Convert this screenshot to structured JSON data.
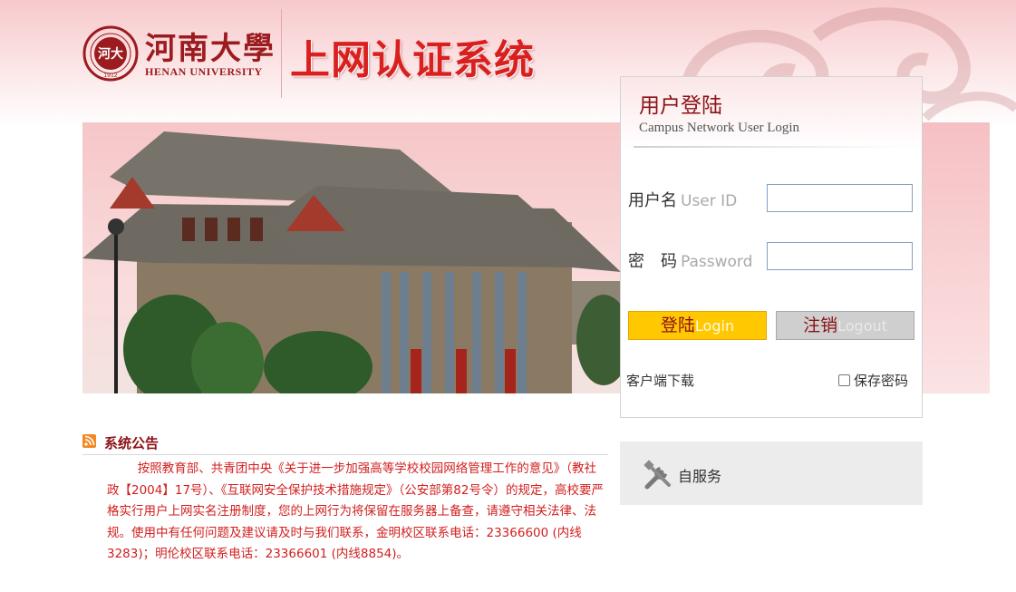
{
  "header": {
    "university_name_cn": "河南大學",
    "university_name_en": "HENAN UNIVERSITY",
    "seal_text": "HENAN UNIVERSITY 1912",
    "system_title": "上网认证系统"
  },
  "login": {
    "title": "用户登陆",
    "subtitle": "Campus Network User Login",
    "username_label": "用户名",
    "username_label_en": "User ID",
    "username_value": "",
    "password_label": "密　码",
    "password_label_en": "Password",
    "password_value": "",
    "login_button": "登陆",
    "login_button_en": "Login",
    "logout_button": "注销",
    "logout_button_en": "Logout",
    "client_download": "客户端下载",
    "remember_password": "保存密码"
  },
  "self_service": {
    "label": "自服务",
    "icon": "tools-icon"
  },
  "notice": {
    "title": "系统公告",
    "icon": "rss-icon",
    "body": "按照教育部、共青团中央《关于进一步加强高等学校校园网络管理工作的意见》（教社政【2004】17号）、《互联网安全保护技术措施规定》（公安部第82号令）的规定，高校要严格实行用户上网实名注册制度，您的上网行为将保留在服务器上备查，请遵守相关法律、法规。使用中有任何问题及建议请及时与我们联系，金明校区联系电话：23366600 (内线3283)；明伦校区联系电话：23366601 (内线8854)。"
  },
  "colors": {
    "brand_red": "#8c1216",
    "title_red": "#d9201f",
    "notice_red": "#d21e1e",
    "login_yellow": "#ffc800",
    "logout_gray": "#cfcfcf"
  }
}
